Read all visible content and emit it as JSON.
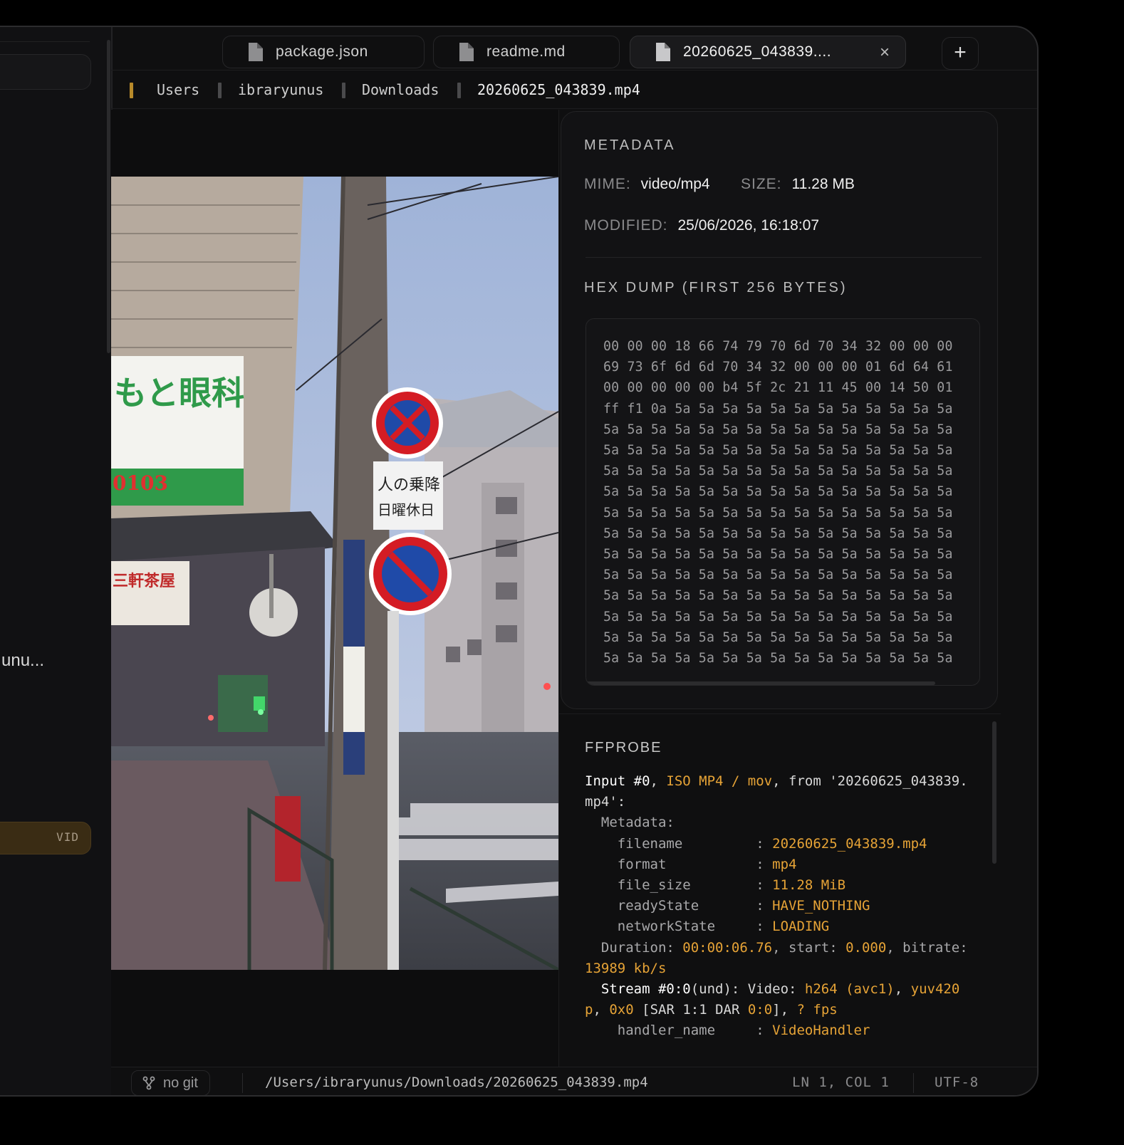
{
  "sidebar": {
    "truncated_item": "unu...",
    "badge": "VID"
  },
  "tabs": [
    {
      "label": "package.json",
      "active": false
    },
    {
      "label": "readme.md",
      "active": false
    },
    {
      "label": "20260625_043839....",
      "active": true,
      "close": "×"
    }
  ],
  "new_tab_label": "+",
  "breadcrumb": [
    "Users",
    "ibraryunus",
    "Downloads",
    "20260625_043839.mp4"
  ],
  "metadata": {
    "heading": "METADATA",
    "mime_label": "MIME:",
    "mime": "video/mp4",
    "size_label": "SIZE:",
    "size": "11.28 MB",
    "modified_label": "MODIFIED:",
    "modified": "25/06/2026, 16:18:07"
  },
  "hexdump": {
    "heading": "HEX DUMP (FIRST 256 BYTES)",
    "lines": [
      "00 00 00 18 66 74 79 70 6d 70 34 32 00 00 00",
      "69 73 6f 6d 6d 70 34 32 00 00 00 01 6d 64 61",
      "00 00 00 00 00 b4 5f 2c 21 11 45 00 14 50 01",
      "ff f1 0a 5a 5a 5a 5a 5a 5a 5a 5a 5a 5a 5a 5a",
      "5a 5a 5a 5a 5a 5a 5a 5a 5a 5a 5a 5a 5a 5a 5a",
      "5a 5a 5a 5a 5a 5a 5a 5a 5a 5a 5a 5a 5a 5a 5a",
      "5a 5a 5a 5a 5a 5a 5a 5a 5a 5a 5a 5a 5a 5a 5a",
      "5a 5a 5a 5a 5a 5a 5a 5a 5a 5a 5a 5a 5a 5a 5a",
      "5a 5a 5a 5a 5a 5a 5a 5a 5a 5a 5a 5a 5a 5a 5a",
      "5a 5a 5a 5a 5a 5a 5a 5a 5a 5a 5a 5a 5a 5a 5a",
      "5a 5a 5a 5a 5a 5a 5a 5a 5a 5a 5a 5a 5a 5a 5a",
      "5a 5a 5a 5a 5a 5a 5a 5a 5a 5a 5a 5a 5a 5a 5a",
      "5a 5a 5a 5a 5a 5a 5a 5a 5a 5a 5a 5a 5a 5a 5a",
      "5a 5a 5a 5a 5a 5a 5a 5a 5a 5a 5a 5a 5a 5a 5a",
      "5a 5a 5a 5a 5a 5a 5a 5a 5a 5a 5a 5a 5a 5a 5a",
      "5a 5a 5a 5a 5a 5a 5a 5a 5a 5a 5a 5a 5a 5a 5a"
    ]
  },
  "ffprobe": {
    "heading": "FFPROBE",
    "input_label": "Input #0",
    "input_format": "ISO MP4 / mov",
    "input_from": ", from '20260625_043839.mp4':",
    "metadata_label": "Metadata:",
    "fields": [
      {
        "key": "filename",
        "value": "20260625_043839.mp4"
      },
      {
        "key": "format",
        "value": "mp4"
      },
      {
        "key": "file_size",
        "value": "11.28 MiB"
      },
      {
        "key": "readyState",
        "value": "HAVE_NOTHING"
      },
      {
        "key": "networkState",
        "value": "LOADING"
      }
    ],
    "duration": "00:00:06.76",
    "start": "0.000",
    "bitrate": "13989 kb/s",
    "stream_label": "Stream #0:0",
    "stream_lang": "(und): Video: ",
    "codec": "h264 (avc1)",
    "pixfmt": "yuv420p",
    "dims": "0x0",
    "sar": "[SAR 1:1 DAR ",
    "dar": "0:0",
    "fps": "? fps",
    "handler_key": "handler_name",
    "handler_value": "VideoHandler"
  },
  "status": {
    "git": "no git",
    "path": "/Users/ibraryunus/Downloads/20260625_043839.mp4",
    "position": "LN 1, COL 1",
    "encoding": "UTF-8"
  },
  "colors": {
    "accent": "#e6a336",
    "background": "#0f0f10",
    "sign_red": "#d41c24",
    "sign_blue": "#1f4aa8"
  },
  "icons": [
    "file-icon",
    "close-icon",
    "plus-icon",
    "git-branch-icon"
  ]
}
